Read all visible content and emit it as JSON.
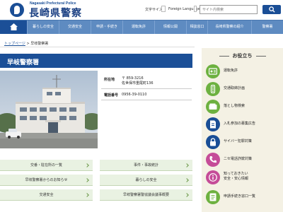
{
  "header": {
    "logo_sub": "Nagasaki Prefectural Police",
    "logo_title": "長崎県警察",
    "font_size_label": "文字サイズ",
    "foreign_language_label": "Foreign Language",
    "search_placeholder": "サイト内検索"
  },
  "nav": {
    "items": [
      "暮らしの安全",
      "交通安全",
      "申請・手続き",
      "運転免許",
      "情報公開",
      "相談窓口",
      "長崎県警察の紹介",
      "警察署"
    ]
  },
  "breadcrumb": {
    "home": "トップページ",
    "separator": ">",
    "current": "早岐警察署"
  },
  "main": {
    "title": "早岐警察署",
    "address_label": "所在地",
    "postal": "〒 859-3216",
    "address": "佐世保市重尾町136",
    "phone_label": "電話番号",
    "phone": "0956-39-0110"
  },
  "links": [
    "交番・駐在所の一覧",
    "事件・事故統計",
    "早岐警察署からのお知らせ",
    "暮らしの安全",
    "交通安全",
    "早岐警察署警協議会議事概要"
  ],
  "sidebar": {
    "title": "お役立ち",
    "items": [
      {
        "label": "運転免許",
        "icon": "id-card-icon",
        "color": "#6db140"
      },
      {
        "label": "交通取締計画",
        "icon": "traffic-signal-icon",
        "color": "#6db140"
      },
      {
        "label": "落とし物検索",
        "icon": "wallet-icon",
        "color": "#6db140"
      },
      {
        "label": "入札参加の募集広告",
        "icon": "document-icon",
        "color": "#1a4e96"
      },
      {
        "label": "サイバー犯罪対策",
        "icon": "lock-icon",
        "color": "#1a4e96"
      },
      {
        "label": "ニセ電話詐欺対策",
        "icon": "phone-icon",
        "color": "#c54c98"
      },
      {
        "label": "知っておきたい 安全・安心情報",
        "line1": "知っておきたい",
        "line2": "安全・安心情報",
        "icon": "info-icon",
        "color": "#c54c98"
      },
      {
        "label": "申請手続き窓口一覧",
        "icon": "form-icon",
        "color": "#6db140"
      }
    ]
  },
  "colors": {
    "brand_dark": "#1b4f97",
    "nav_bg": "#5e8bc1",
    "sidebar_bg": "#f4f1e4",
    "link_bg": "#e9f2e2"
  }
}
